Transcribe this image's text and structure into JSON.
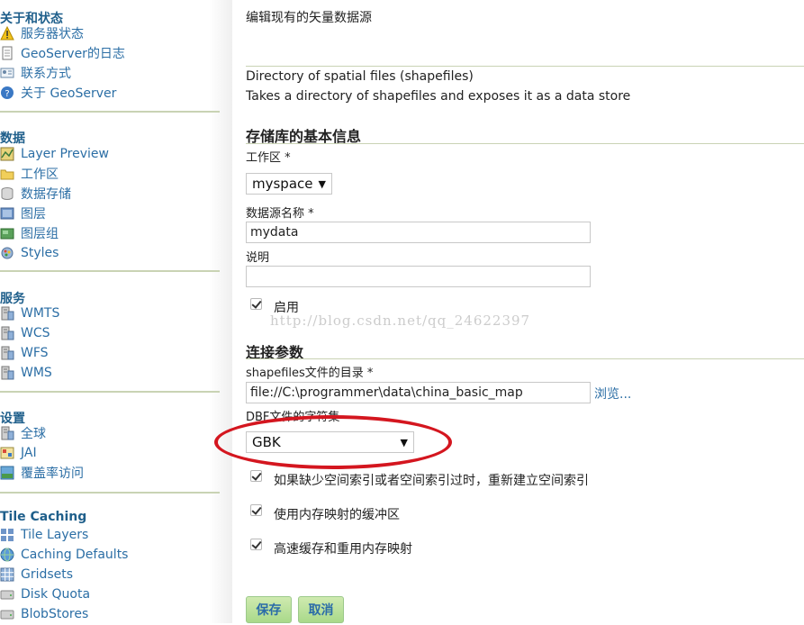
{
  "sidebar": {
    "sections": [
      {
        "title": "关于和状态",
        "items": [
          {
            "label": "服务器状态",
            "icon": "warning-icon"
          },
          {
            "label": "GeoServer的日志",
            "icon": "document-icon"
          },
          {
            "label": "联系方式",
            "icon": "contact-card-icon"
          },
          {
            "label": "关于 GeoServer",
            "icon": "help-icon"
          }
        ]
      },
      {
        "title": "数据",
        "items": [
          {
            "label": "Layer Preview",
            "icon": "map-preview-icon"
          },
          {
            "label": "工作区",
            "icon": "folder-icon"
          },
          {
            "label": "数据存储",
            "icon": "database-icon"
          },
          {
            "label": "图层",
            "icon": "layer-icon"
          },
          {
            "label": "图层组",
            "icon": "layer-group-icon"
          },
          {
            "label": "Styles",
            "icon": "style-icon"
          }
        ]
      },
      {
        "title": "服务",
        "items": [
          {
            "label": "WMTS",
            "icon": "server-icon"
          },
          {
            "label": "WCS",
            "icon": "server-icon"
          },
          {
            "label": "WFS",
            "icon": "server-icon"
          },
          {
            "label": "WMS",
            "icon": "server-icon"
          }
        ]
      },
      {
        "title": "设置",
        "items": [
          {
            "label": "全球",
            "icon": "server-icon"
          },
          {
            "label": "JAI",
            "icon": "image-icon"
          },
          {
            "label": "覆盖率访问",
            "icon": "coverage-icon"
          }
        ]
      },
      {
        "title": "Tile Caching",
        "items": [
          {
            "label": "Tile Layers",
            "icon": "tiles-icon"
          },
          {
            "label": "Caching Defaults",
            "icon": "globe-icon"
          },
          {
            "label": "Gridsets",
            "icon": "grid-icon"
          },
          {
            "label": "Disk Quota",
            "icon": "disk-icon"
          },
          {
            "label": "BlobStores",
            "icon": "disk-icon"
          }
        ]
      }
    ]
  },
  "main": {
    "page_title": "编辑现有的矢量数据源",
    "store_type": "Directory of spatial files (shapefiles)",
    "store_desc": "Takes a directory of shapefiles and exposes it as a data store",
    "basic_heading": "存储库的基本信息",
    "workspace_label": "工作区 *",
    "workspace_value": "myspace",
    "name_label": "数据源名称 *",
    "name_value": "mydata",
    "desc_label": "说明",
    "desc_value": "",
    "enabled_label": "启用",
    "watermark": "http://blog.csdn.net/qq_24622397",
    "conn_heading": "连接参数",
    "dir_label": "shapefiles文件的目录 *",
    "dir_value": "file://C:\\programmer\\data\\china_basic_map",
    "browse_label": "浏览...",
    "charset_label": "DBF文件的字符集",
    "charset_value": "GBK",
    "opt1_label": "如果缺少空间索引或者空间索引过时，重新建立空间索引",
    "opt2_label": "使用内存映射的缓冲区",
    "opt3_label": "高速缓存和重用内存映射",
    "save_label": "保存",
    "cancel_label": "取消"
  },
  "colors": {
    "accent": "#2b6ea5",
    "heading": "#1f5f8b",
    "highlight": "#d4161f",
    "button": "#b7e09a"
  }
}
